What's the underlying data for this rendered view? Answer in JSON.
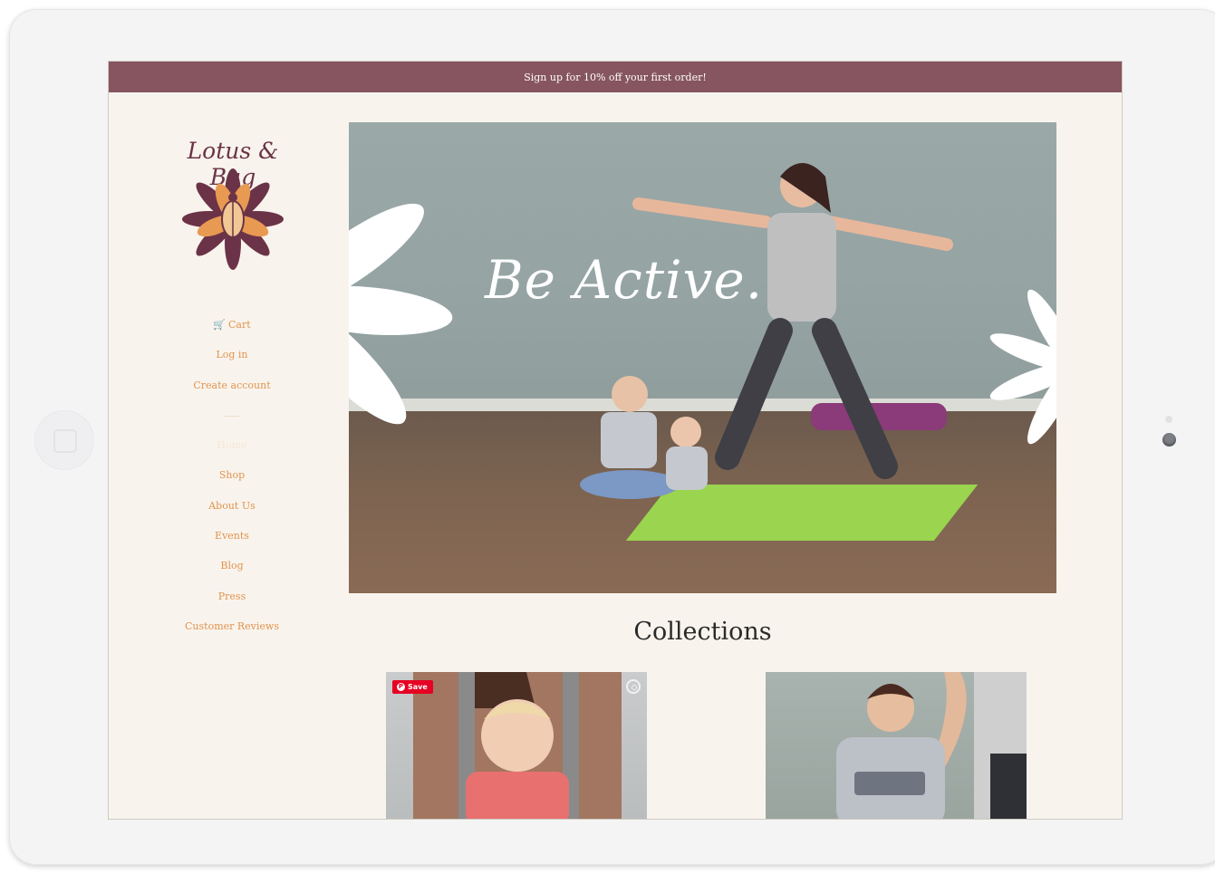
{
  "promo": {
    "text": "Sign up for 10% off your first order!"
  },
  "brand": {
    "name": "Lotus & Bug"
  },
  "nav": {
    "cart": "Cart",
    "login": "Log in",
    "create_account": "Create account",
    "items": [
      "Home",
      "Shop",
      "About Us",
      "Events",
      "Blog",
      "Press",
      "Customer Reviews"
    ],
    "current": "Home"
  },
  "hero": {
    "tagline": "Be Active."
  },
  "collections": {
    "title": "Collections",
    "save_label": "Save",
    "cards": [
      {
        "name": "collection-card-1"
      },
      {
        "name": "collection-card-2"
      }
    ]
  },
  "colors": {
    "promo_bg": "#86555f",
    "page_bg": "#f8f4ed",
    "nav_link": "#e2934e",
    "logo_primary": "#6b3347",
    "logo_accent": "#e89a52"
  }
}
